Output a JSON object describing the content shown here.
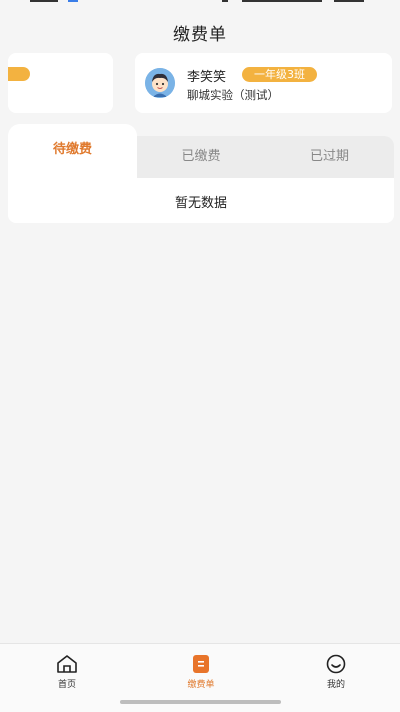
{
  "page": {
    "title": "缴费单"
  },
  "student": {
    "name": "李笑笑",
    "class": "一年级3班",
    "school": "聊城实验（测试）"
  },
  "tabs": [
    {
      "label": "待缴费",
      "active": true
    },
    {
      "label": "已缴费",
      "active": false
    },
    {
      "label": "已过期",
      "active": false
    }
  ],
  "content": {
    "empty_text": "暂无数据"
  },
  "tabbar": {
    "items": [
      {
        "label": "首页",
        "icon": "home-icon",
        "active": false
      },
      {
        "label": "缴费单",
        "icon": "bill-icon",
        "active": true
      },
      {
        "label": "我的",
        "icon": "profile-icon",
        "active": false
      }
    ]
  },
  "colors": {
    "accent": "#e07a2e",
    "badge": "#f3b240",
    "background": "#f5f5f5"
  }
}
